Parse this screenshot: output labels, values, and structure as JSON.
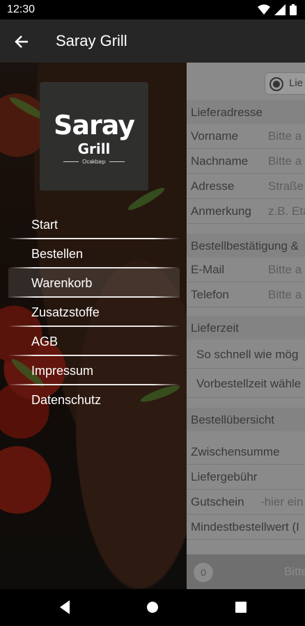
{
  "status_bar": {
    "time": "12:30"
  },
  "app_bar": {
    "title": "Saray Grill"
  },
  "logo": {
    "word1": "Saray",
    "word2": "Grill",
    "tagline": "Ocakbaşı"
  },
  "drawer": {
    "items": [
      {
        "label": "Start",
        "active": false
      },
      {
        "label": "Bestellen",
        "active": false
      },
      {
        "label": "Warenkorb",
        "active": true
      },
      {
        "label": "Zusatzstoffe",
        "active": false
      },
      {
        "label": "AGB",
        "active": false
      },
      {
        "label": "Impressum",
        "active": false
      },
      {
        "label": "Datenschutz",
        "active": false
      }
    ]
  },
  "form": {
    "delivery_option": "Lie",
    "sections": {
      "address": "Lieferadresse",
      "confirmation": "Bestellbestätigung &",
      "delivery_time": "Lieferzeit",
      "summary": "Bestellübersicht"
    },
    "fields": {
      "first_name": {
        "label": "Vorname",
        "placeholder": "Bitte a"
      },
      "last_name": {
        "label": "Nachname",
        "placeholder": "Bitte a"
      },
      "address": {
        "label": "Adresse",
        "placeholder": "Straße,"
      },
      "note": {
        "label": "Anmerkung",
        "placeholder": "z.B. Eta"
      },
      "email": {
        "label": "E-Mail",
        "placeholder": "Bitte a"
      },
      "phone": {
        "label": "Telefon",
        "placeholder": "Bitte a"
      }
    },
    "time_options": {
      "asap": "So schnell wie mög",
      "preorder": "Vorbestellzeit wähle"
    },
    "summary": {
      "subtotal": "Zwischensumme",
      "delivery_fee": "Liefergebühr",
      "voucher_label": "Gutschein",
      "voucher_placeholder": "-hier ein",
      "min_order": "Mindestbestellwert (I"
    },
    "bottom": {
      "count": "0",
      "label": "Bitte"
    }
  }
}
